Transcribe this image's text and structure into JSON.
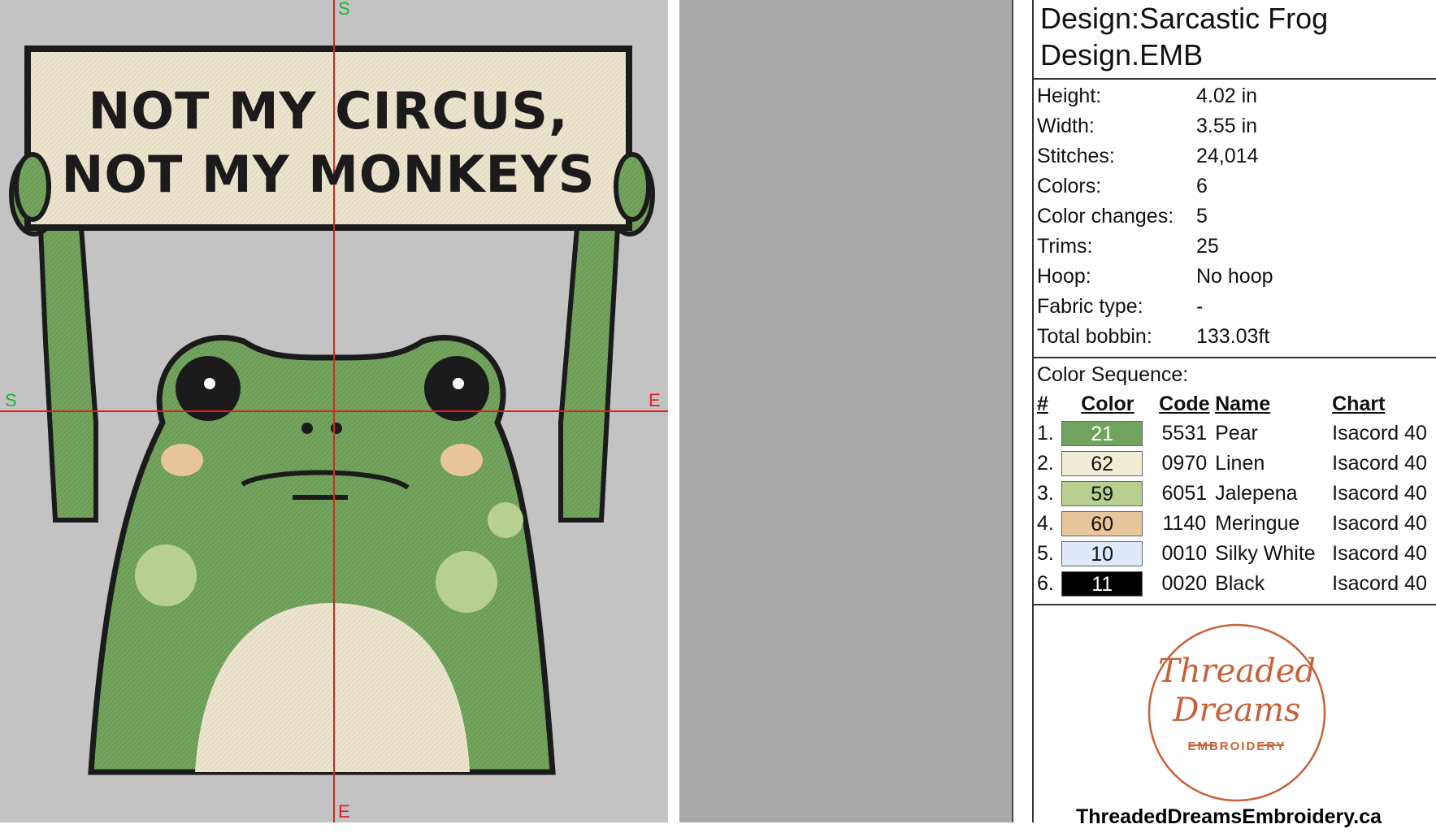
{
  "canvas": {
    "guide_labels": {
      "top": "S",
      "left": "S",
      "right": "E",
      "bottom": "E"
    },
    "sign_text": {
      "line1": "NOT MY CIRCUS,",
      "line2": "NOT MY MONKEYS"
    },
    "colors": {
      "background": "#c3c3c3",
      "frog": "#74a55f",
      "linen": "#ece5cf",
      "guide": "#e02020",
      "outline": "#1b1b1b"
    }
  },
  "info": {
    "title_line1": "Design:Sarcastic Frog",
    "title_line2": "Design.EMB",
    "properties": [
      {
        "label": "Height:",
        "value": "4.02 in"
      },
      {
        "label": "Width:",
        "value": "3.55 in"
      },
      {
        "label": "Stitches:",
        "value": "24,014"
      },
      {
        "label": "Colors:",
        "value": "6"
      },
      {
        "label": "Color changes:",
        "value": "5"
      },
      {
        "label": "Trims:",
        "value": "25"
      },
      {
        "label": "Hoop:",
        "value": "No hoop"
      },
      {
        "label": "Fabric type:",
        "value": "-"
      },
      {
        "label": "Total bobbin:",
        "value": "133.03ft"
      }
    ],
    "sequence_title": "Color Sequence:",
    "columns": {
      "num": "#",
      "color": "Color",
      "code": "Code",
      "name": "Name",
      "chart": "Chart"
    },
    "sequence": [
      {
        "num": "1.",
        "color": "21",
        "code": "5531",
        "name": "Pear",
        "chart": "Isacord 40",
        "hex": "#6fa35e",
        "text_color": "#ffffff"
      },
      {
        "num": "2.",
        "color": "62",
        "code": "0970",
        "name": "Linen",
        "chart": "Isacord 40",
        "hex": "#f3ecd5",
        "text_color": "#111111"
      },
      {
        "num": "3.",
        "color": "59",
        "code": "6051",
        "name": "Jalepena",
        "chart": "Isacord 40",
        "hex": "#b7cf8f",
        "text_color": "#111111"
      },
      {
        "num": "4.",
        "color": "60",
        "code": "1140",
        "name": "Meringue",
        "chart": "Isacord 40",
        "hex": "#e8c59b",
        "text_color": "#111111"
      },
      {
        "num": "5.",
        "color": "10",
        "code": "0010",
        "name": "Silky White",
        "chart": "Isacord 40",
        "hex": "#dde8fb",
        "text_color": "#111111"
      },
      {
        "num": "6.",
        "color": "11",
        "code": "0020",
        "name": "Black",
        "chart": "Isacord 40",
        "hex": "#000000",
        "text_color": "#ffffff"
      }
    ]
  },
  "logo": {
    "line1": "Threaded",
    "line2": "Dreams",
    "line3": "EMBROIDERY",
    "website": "ThreadedDreamsEmbroidery.ca",
    "color": "#c8613a"
  }
}
